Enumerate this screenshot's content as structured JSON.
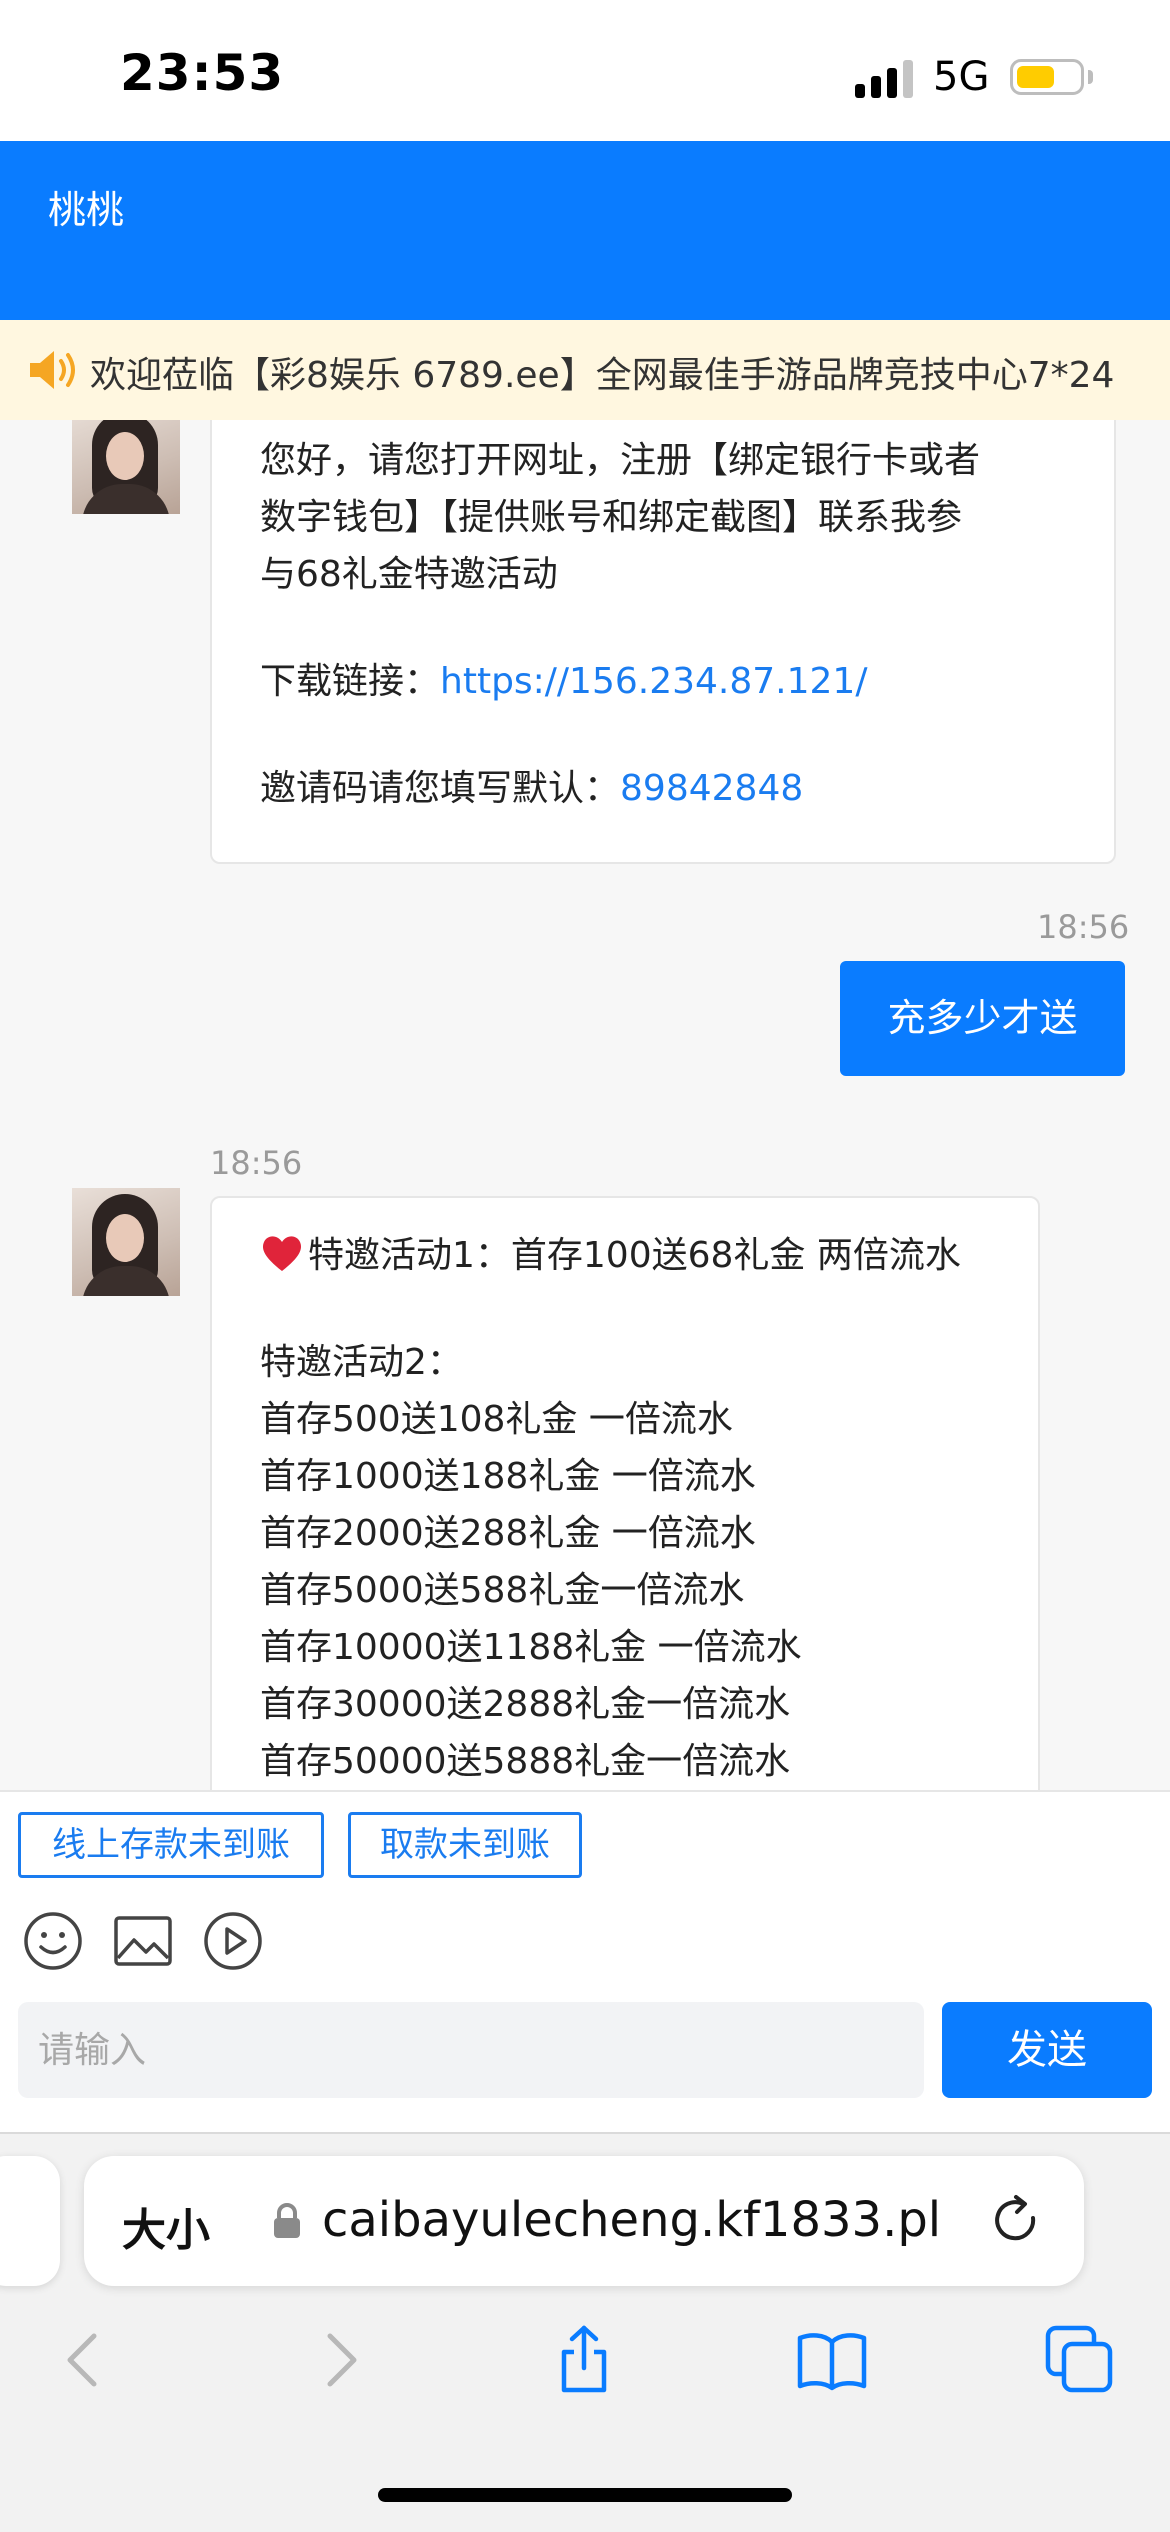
{
  "status_bar": {
    "time": "23:53",
    "network": "5G",
    "battery_level": 0.6
  },
  "header": {
    "title": "桃桃"
  },
  "notice": {
    "text": "欢迎莅临【彩8娱乐 6789.ee】全网最佳手游品牌竞技中心7*24"
  },
  "messages": {
    "first": {
      "lines": [
        "您好，请您打开网址，注册【绑定银行卡或者",
        "数字钱包】【提供账号和绑定截图】联系我参",
        "与68礼金特邀活动"
      ],
      "download_label": "下载链接：",
      "download_url": "https://156.234.87.121/",
      "invite_label": "邀请码请您填写默认：",
      "invite_code": "89842848"
    },
    "mine": {
      "time": "18:56",
      "text": "充多少才送"
    },
    "second": {
      "time": "18:56",
      "activity1": "特邀活动1：首存100送68礼金 两倍流水",
      "activity2_title": "特邀活动2：",
      "activity2_lines": [
        "首存500送108礼金 一倍流水",
        "首存1000送188礼金 一倍流水",
        "首存2000送288礼金 一倍流水",
        "首存5000送588礼金一倍流水",
        "首存10000送1188礼金 一倍流水",
        "首存30000送2888礼金一倍流水",
        "首存50000送5888礼金一倍流水"
      ]
    }
  },
  "quick_replies": [
    "线上存款未到账",
    "取款未到账"
  ],
  "input": {
    "placeholder": "请输入",
    "send_label": "发送"
  },
  "safari": {
    "text_size_label": "大小",
    "url": "caibayulecheng.kf1833.pl"
  },
  "colors": {
    "primary": "#0a7cff",
    "link": "#1a7cf0",
    "notice_bg": "#fff7e0"
  }
}
